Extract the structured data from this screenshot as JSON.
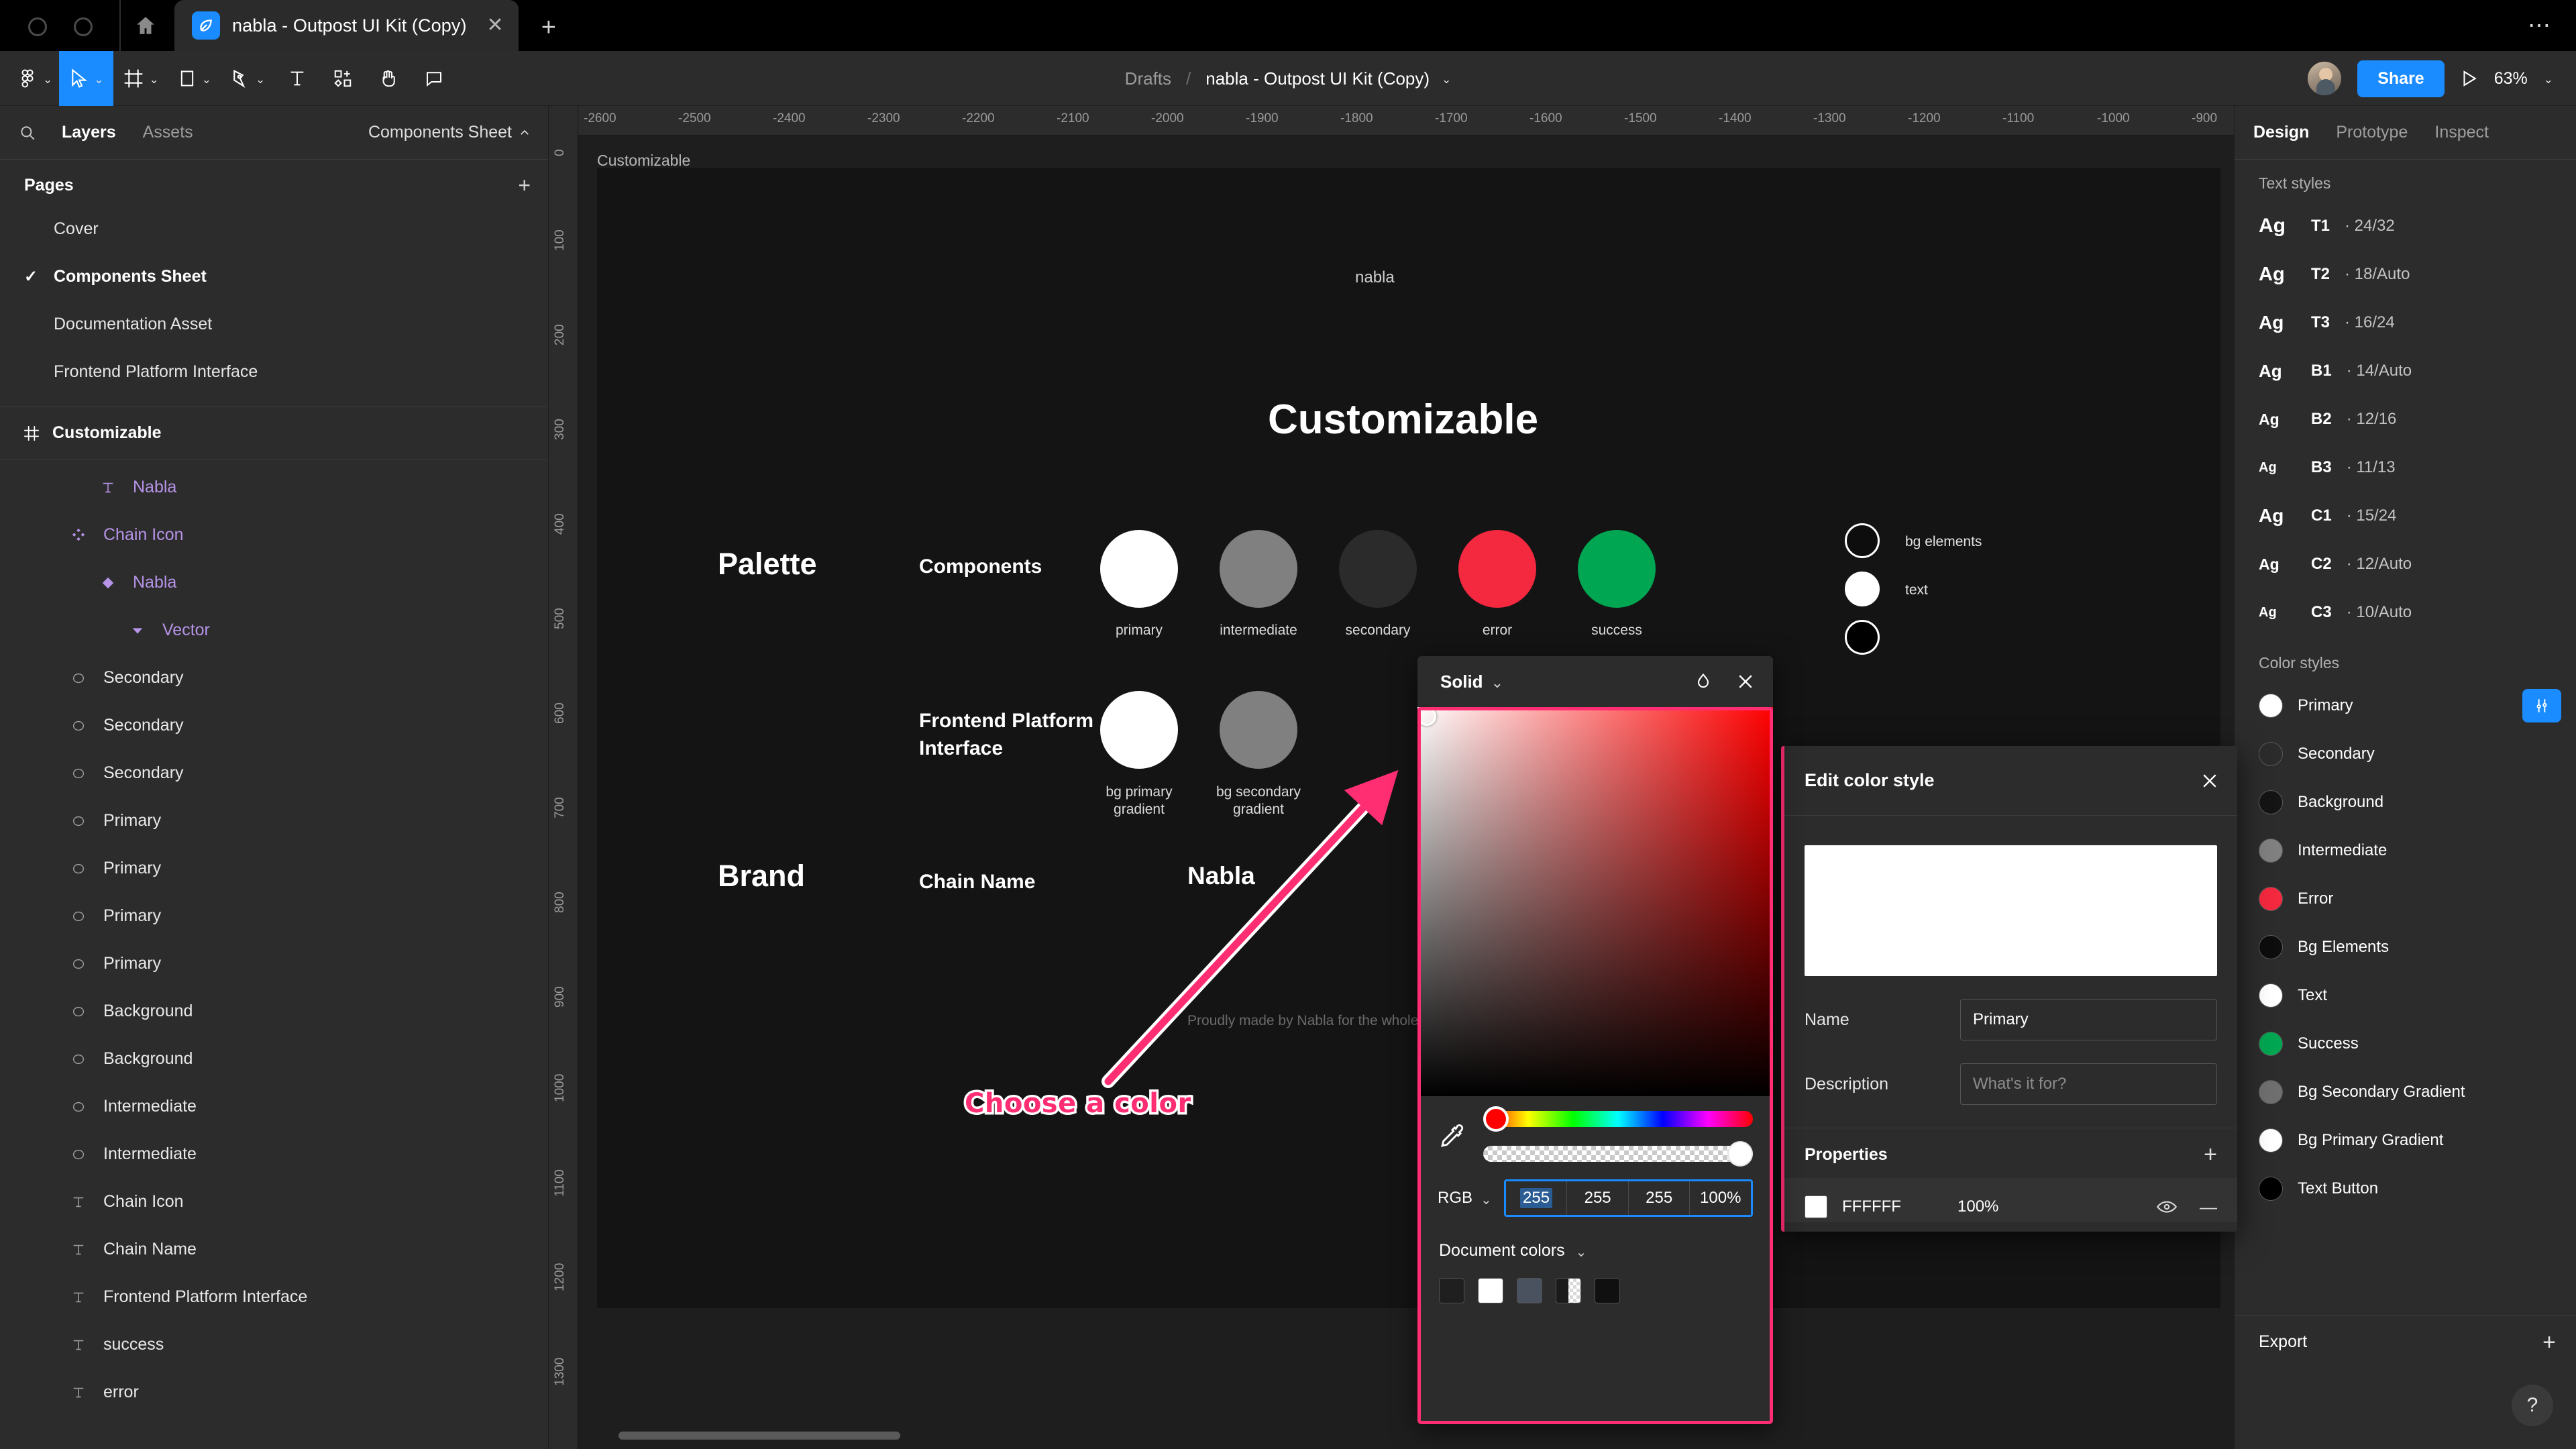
{
  "browser": {
    "tab_title": "nabla - Outpost UI Kit (Copy)",
    "tab_close": "✕",
    "new_tab": "+",
    "menu": "⋯"
  },
  "toolbar": {
    "breadcrumb_root": "Drafts",
    "breadcrumb_sep": "/",
    "file_name": "nabla - Outpost UI Kit (Copy)",
    "share_label": "Share",
    "zoom_level": "63%",
    "caret": "⌄"
  },
  "left_panel": {
    "tabs": [
      {
        "label": "Layers",
        "active": true
      },
      {
        "label": "Assets",
        "active": false
      }
    ],
    "sheet_selector": "Components Sheet",
    "pages_title": "Pages",
    "add_page": "+",
    "pages": [
      {
        "label": "Cover",
        "selected": false
      },
      {
        "label": "Components Sheet",
        "selected": true
      },
      {
        "label": "Documentation Asset",
        "selected": false
      },
      {
        "label": "Frontend Platform Interface",
        "selected": false
      }
    ],
    "frame_name": "Customizable",
    "layers": [
      {
        "label": "Nabla",
        "icon": "text-icon",
        "indent": 2,
        "purple": true
      },
      {
        "label": "Chain Icon",
        "icon": "component-icon",
        "indent": 1,
        "purple": true
      },
      {
        "label": "Nabla",
        "icon": "instance-icon",
        "indent": 2,
        "purple": true
      },
      {
        "label": "Vector",
        "icon": "vector-icon",
        "indent": 3,
        "purple": true
      },
      {
        "label": "Secondary",
        "icon": "ellipse-icon",
        "indent": 1,
        "purple": false
      },
      {
        "label": "Secondary",
        "icon": "ellipse-icon",
        "indent": 1,
        "purple": false
      },
      {
        "label": "Secondary",
        "icon": "ellipse-icon",
        "indent": 1,
        "purple": false
      },
      {
        "label": "Primary",
        "icon": "ellipse-icon",
        "indent": 1,
        "purple": false
      },
      {
        "label": "Primary",
        "icon": "ellipse-icon",
        "indent": 1,
        "purple": false
      },
      {
        "label": "Primary",
        "icon": "ellipse-icon",
        "indent": 1,
        "purple": false
      },
      {
        "label": "Primary",
        "icon": "ellipse-icon",
        "indent": 1,
        "purple": false
      },
      {
        "label": "Background",
        "icon": "ellipse-icon",
        "indent": 1,
        "purple": false
      },
      {
        "label": "Background",
        "icon": "ellipse-icon",
        "indent": 1,
        "purple": false
      },
      {
        "label": "Intermediate",
        "icon": "ellipse-icon",
        "indent": 1,
        "purple": false
      },
      {
        "label": "Intermediate",
        "icon": "ellipse-icon",
        "indent": 1,
        "purple": false
      },
      {
        "label": "Chain Icon",
        "icon": "text-icon",
        "indent": 1,
        "purple": false
      },
      {
        "label": "Chain Name",
        "icon": "text-icon",
        "indent": 1,
        "purple": false
      },
      {
        "label": "Frontend Platform Interface",
        "icon": "text-icon",
        "indent": 1,
        "purple": false
      },
      {
        "label": "success",
        "icon": "text-icon",
        "indent": 1,
        "purple": false
      },
      {
        "label": "error",
        "icon": "text-icon",
        "indent": 1,
        "purple": false
      }
    ]
  },
  "right_panel": {
    "tabs": [
      {
        "label": "Design",
        "active": true
      },
      {
        "label": "Prototype",
        "active": false
      },
      {
        "label": "Inspect",
        "active": false
      }
    ],
    "text_styles_title": "Text styles",
    "text_styles": [
      {
        "sample": "Ag",
        "name": "T1",
        "meta": "· 24/32",
        "size": 30
      },
      {
        "sample": "Ag",
        "name": "T2",
        "meta": "· 18/Auto",
        "size": 29
      },
      {
        "sample": "Ag",
        "name": "T3",
        "meta": "· 16/24",
        "size": 28
      },
      {
        "sample": "Ag",
        "name": "B1",
        "meta": "· 14/Auto",
        "size": 26
      },
      {
        "sample": "Ag",
        "name": "B2",
        "meta": "· 12/16",
        "size": 23
      },
      {
        "sample": "Ag",
        "name": "B3",
        "meta": "· 11/13",
        "size": 20
      },
      {
        "sample": "Ag",
        "name": "C1",
        "meta": "· 15/24",
        "size": 28
      },
      {
        "sample": "Ag",
        "name": "C2",
        "meta": "· 12/Auto",
        "size": 23
      },
      {
        "sample": "Ag",
        "name": "C3",
        "meta": "· 10/Auto",
        "size": 20
      }
    ],
    "color_styles_title": "Color styles",
    "color_styles": [
      {
        "name": "Primary",
        "hex": "#ffffff"
      },
      {
        "name": "Secondary",
        "hex": "#2b2b2b"
      },
      {
        "name": "Background",
        "hex": "#141414"
      },
      {
        "name": "Intermediate",
        "hex": "#808080"
      },
      {
        "name": "Error",
        "hex": "#f4283f"
      },
      {
        "name": "Bg Elements",
        "hex": "#0d0d0d"
      },
      {
        "name": "Text",
        "hex": "#ffffff"
      },
      {
        "name": "Success",
        "hex": "#00a651"
      },
      {
        "name": "Bg Secondary Gradient",
        "hex": "#6f6f6f"
      },
      {
        "name": "Bg Primary Gradient",
        "hex": "#ffffff"
      },
      {
        "name": "Text Button",
        "hex": "#000000"
      }
    ],
    "export_label": "Export",
    "export_add": "+",
    "help": "?"
  },
  "canvas": {
    "frame_label": "Customizable",
    "logo_word": "nabla",
    "page_title": "Customizable",
    "sections": [
      {
        "title": "Palette",
        "sub": "Components"
      },
      {
        "title": "",
        "sub": "Frontend Platform\nInterface"
      },
      {
        "title": "Brand",
        "sub": "Chain Name",
        "value": "Nabla"
      }
    ],
    "palette_dots_row1": [
      {
        "label": "primary",
        "hex": "#ffffff"
      },
      {
        "label": "intermediate",
        "hex": "#808080"
      },
      {
        "label": "secondary",
        "hex": "#2b2b2b"
      },
      {
        "label": "error",
        "hex": "#f4283f"
      },
      {
        "label": "success",
        "hex": "#00a651"
      }
    ],
    "palette_dots_row2": [
      {
        "label": "bg primary\ngradient",
        "hex": "#ffffff"
      },
      {
        "label": "bg secondary\ngradient",
        "hex": "#808080"
      }
    ],
    "side_dots": [
      {
        "label": "bg elements",
        "hex": "#0d0d0d"
      },
      {
        "label": "text",
        "hex": "#ffffff"
      },
      {
        "label": "",
        "hex": "#000000"
      }
    ],
    "footer_note": "Proudly made by Nabla for the whole Cos...",
    "ruler_h": [
      "-2600",
      "-2500",
      "-2400",
      "-2300",
      "-2200",
      "-2100",
      "-2000",
      "-1900",
      "-1800",
      "-1700",
      "-1600",
      "-1500",
      "-1400",
      "-1300",
      "-1200",
      "-1100",
      "-1000",
      "-900"
    ],
    "ruler_v": [
      "0",
      "100",
      "200",
      "300",
      "400",
      "500",
      "600",
      "700",
      "800",
      "900",
      "1000",
      "1100",
      "1200",
      "1300"
    ]
  },
  "annotation": {
    "text": "Choose a color",
    "color": "#ff2e73"
  },
  "color_picker": {
    "kind": "Solid",
    "kind_caret": "⌄",
    "mode": "RGB",
    "mode_caret": "⌄",
    "r": "255",
    "g": "255",
    "b": "255",
    "alpha": "100%",
    "document_colors_label": "Document colors",
    "document_colors_caret": "⌄",
    "document_colors": [
      "#1f1f1f",
      "#ffffff",
      "#4a5260",
      "#1a1a1a",
      "#101010"
    ],
    "close": "✕"
  },
  "edit_color_style": {
    "title": "Edit color style",
    "close": "✕",
    "preview_hex": "#ffffff",
    "name_label": "Name",
    "name_value": "Primary",
    "description_label": "Description",
    "description_placeholder": "What's it for?",
    "properties_label": "Properties",
    "properties_add": "+",
    "property_hex": "FFFFFF",
    "property_opacity": "100%",
    "property_remove": "—"
  }
}
